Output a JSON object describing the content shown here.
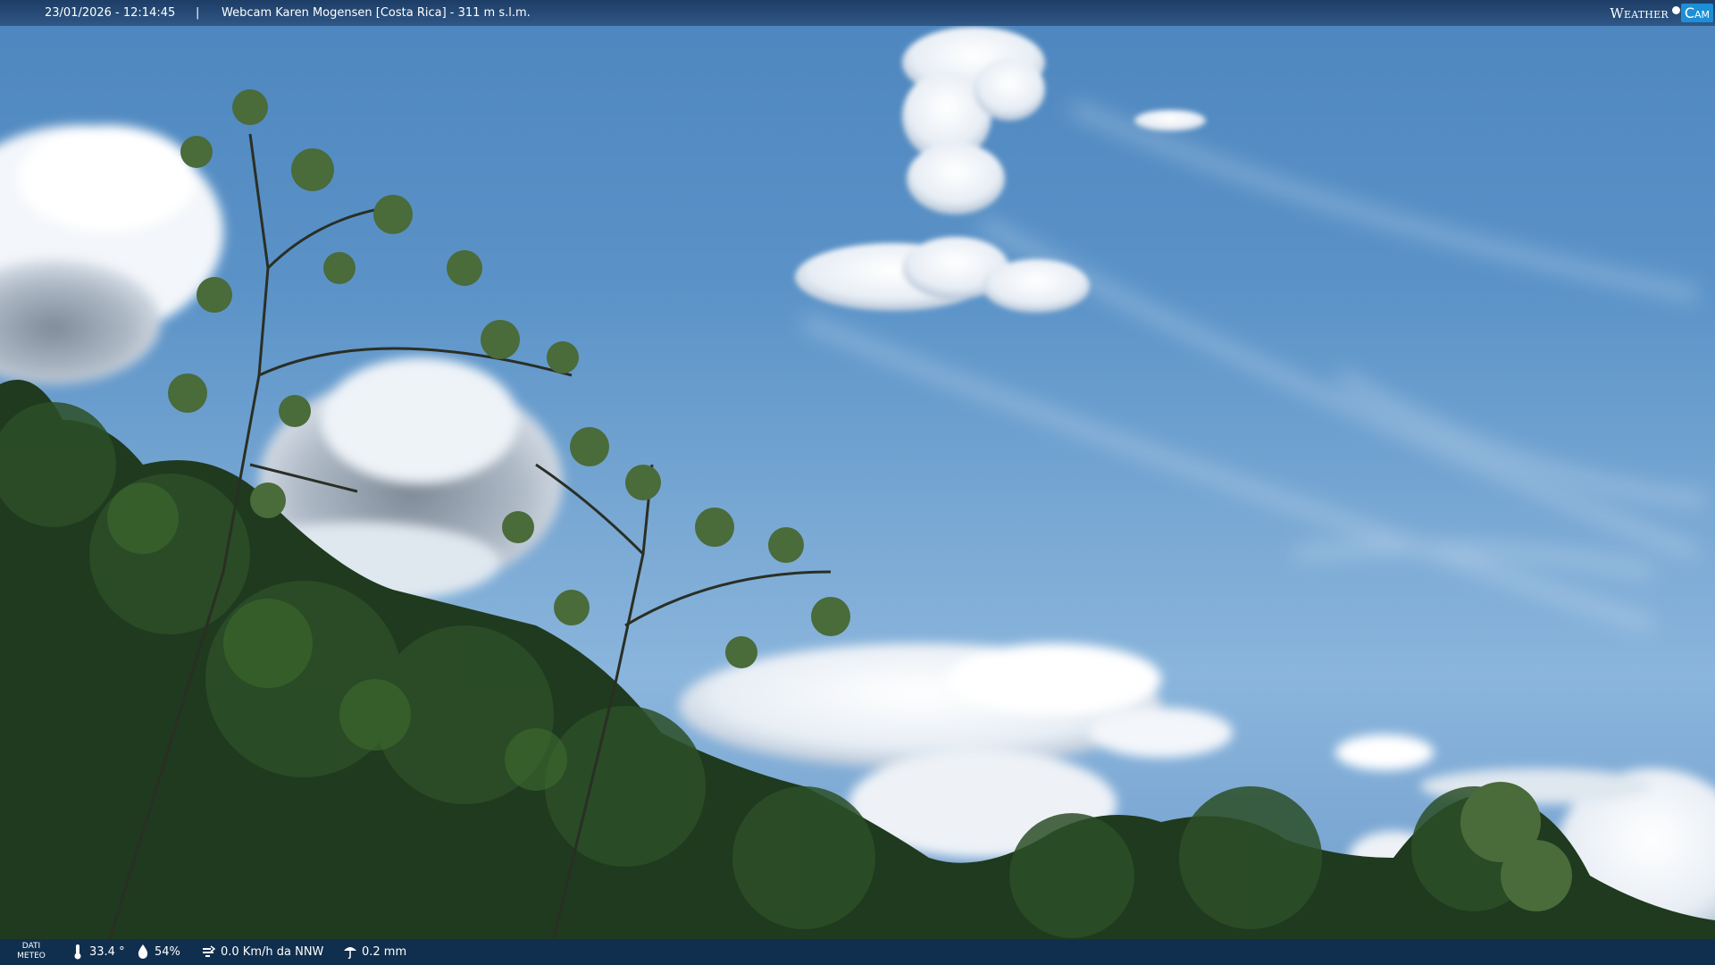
{
  "header": {
    "datetime": "23/01/2026 - 12:14:45",
    "separator": "|",
    "title": "Webcam Karen Mogensen [Costa Rica] - 311 m s.l.m."
  },
  "logo": {
    "weather": "Weather",
    "cam": "Cam"
  },
  "footer": {
    "dati_label_1": "DATI",
    "dati_label_2": "METEO",
    "temperature": "33.4 °",
    "humidity": "54%",
    "wind": "0.0 Km/h da NNW",
    "rain": "0.2 mm"
  },
  "icons": {
    "temperature": "thermometer-icon",
    "humidity": "humidity-drop-icon",
    "wind": "wind-icon",
    "rain": "rain-icon"
  },
  "colors": {
    "sky": "#5b93c8",
    "bar": "#0f2d55",
    "logo_accent": "#1c8fd6",
    "foliage": "#1e3a1c"
  }
}
